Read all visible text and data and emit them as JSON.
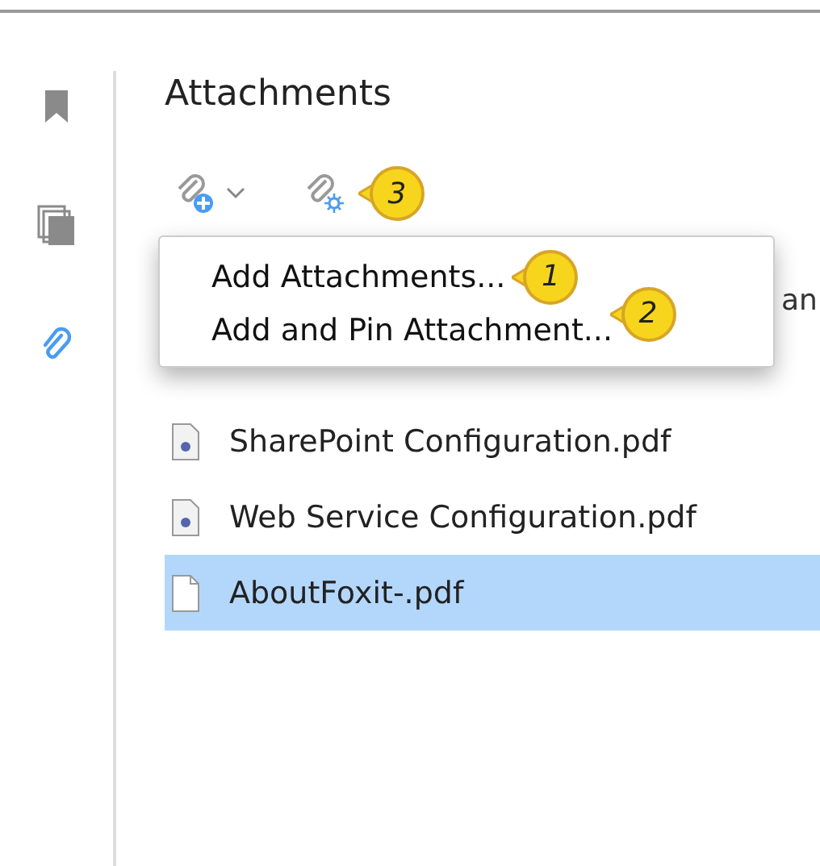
{
  "sidebar": {
    "items": [
      {
        "kind": "bookmark",
        "selected": false
      },
      {
        "kind": "pages",
        "selected": false
      },
      {
        "kind": "attachment",
        "selected": true
      }
    ]
  },
  "panel": {
    "title": "Attachments"
  },
  "toolbar": {
    "callout": "3"
  },
  "menu": {
    "items": [
      {
        "label": "Add Attachments...",
        "callout": "1"
      },
      {
        "label": "Add and Pin Attachment...",
        "callout": "2"
      }
    ],
    "covered_text": "an"
  },
  "files": [
    {
      "name": "SharePoint Configuration.pdf",
      "kind": "pdf",
      "selected": false
    },
    {
      "name": "Web Service Configuration.pdf",
      "kind": "pdf",
      "selected": false
    },
    {
      "name": "AboutFoxit-.pdf",
      "kind": "blank",
      "selected": true
    }
  ]
}
